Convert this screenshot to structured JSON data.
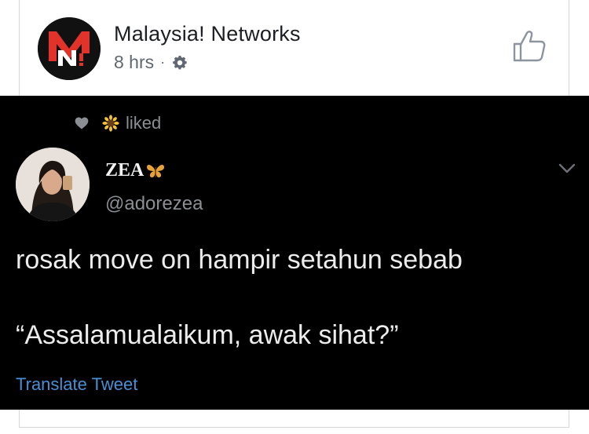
{
  "post_header": {
    "page_name": "Malaysia! Networks",
    "time": "8 hrs",
    "separator": "·",
    "privacy_icon": "gear-icon",
    "like_icon": "thumbs-up-icon",
    "logo_letters": "MN!"
  },
  "tweet": {
    "liked_label": "liked",
    "display_name": "ZEA",
    "handle": "@adorezea",
    "text_line1": "rosak move on hampir setahun sebab",
    "text_line2": "“Assalamualaikum, awak sihat?”",
    "translate_label": "Translate Tweet",
    "icons": [
      "heart-icon",
      "sunflower-icon",
      "butterfly-icon",
      "chevron-down-icon"
    ]
  },
  "colors": {
    "logo_red": "#e2332b",
    "tweet_background": "#000000",
    "link_blue": "#4a8fd4",
    "meta_gray": "#606770"
  }
}
